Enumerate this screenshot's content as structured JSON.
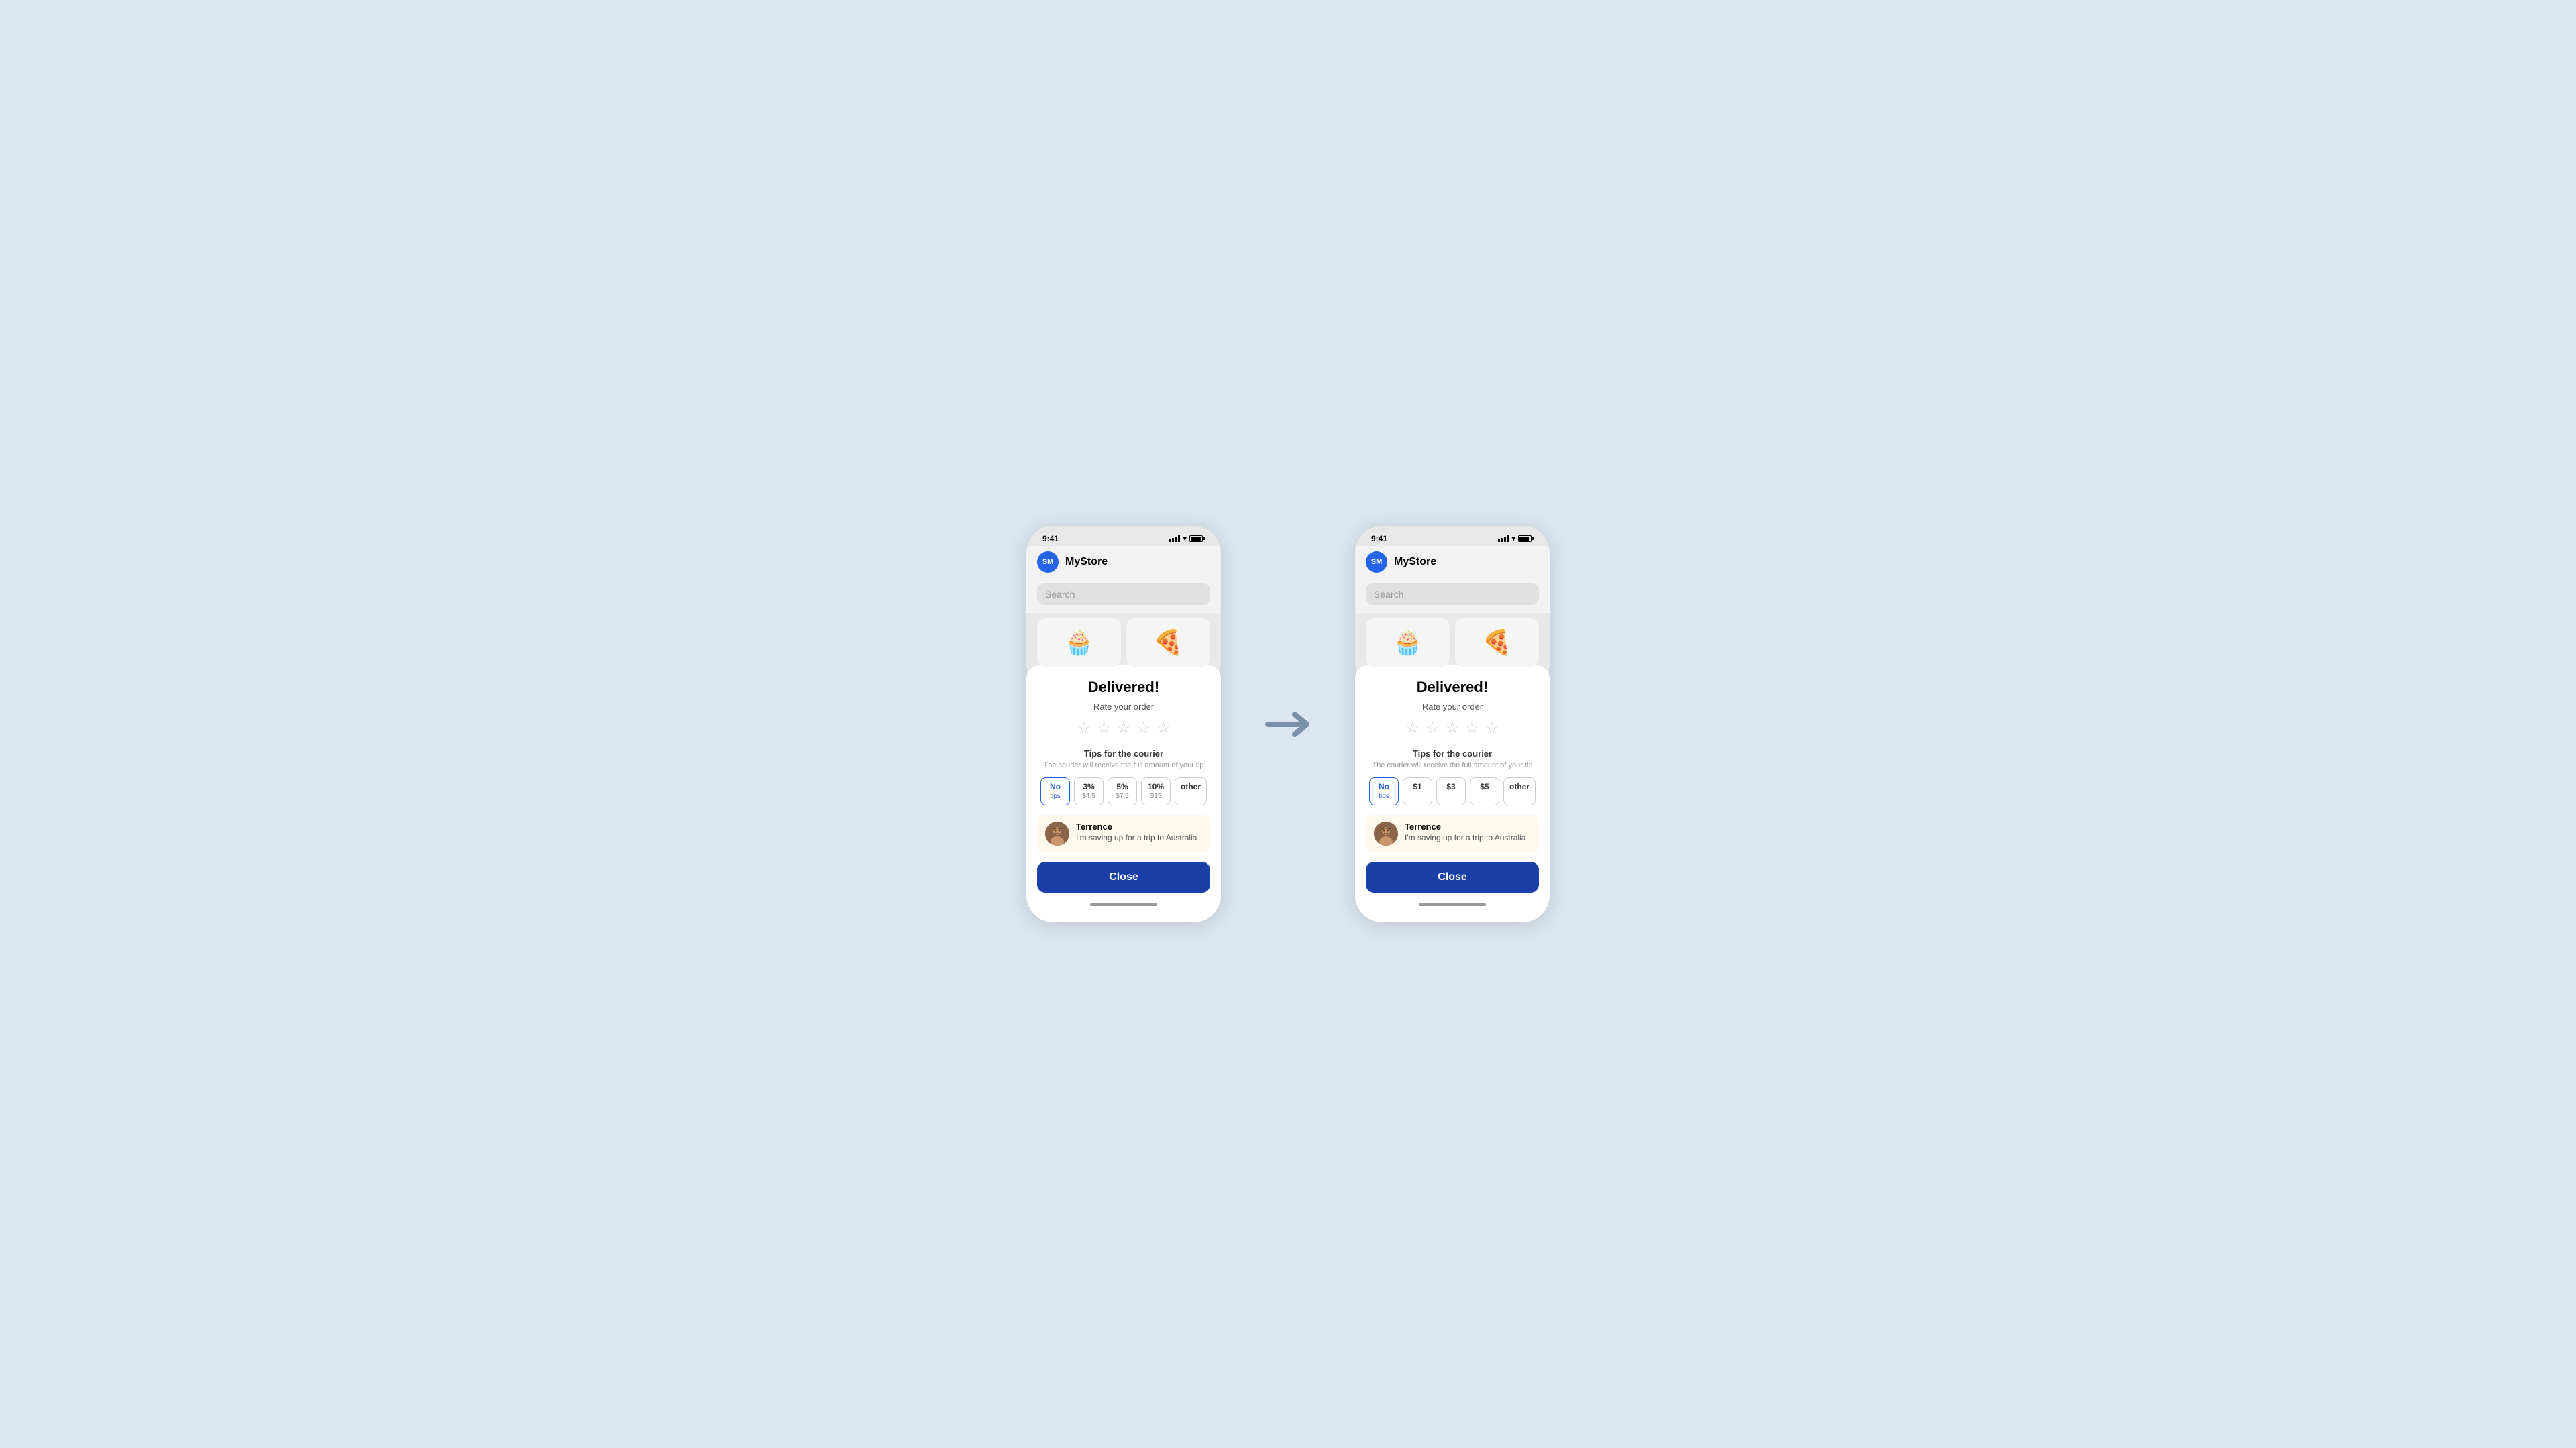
{
  "background_color": "#dde6f0",
  "phone1": {
    "status_bar": {
      "time": "9:41"
    },
    "header": {
      "logo_text": "SM",
      "app_name": "MyStore"
    },
    "search": {
      "placeholder": "Search"
    },
    "products": [
      "🧁",
      "🍕"
    ],
    "sheet": {
      "title": "Delivered!",
      "rate_label": "Rate your order",
      "tips_label": "Tips for the courier",
      "tips_subtitle": "The courier will receive the full amount of your tip",
      "tip_options": [
        {
          "main": "No",
          "sub": "tips",
          "active": true
        },
        {
          "main": "3%",
          "sub": "$4.5",
          "active": false
        },
        {
          "main": "5%",
          "sub": "$7.5",
          "active": false
        },
        {
          "main": "10%",
          "sub": "$15",
          "active": false
        },
        {
          "main": "other",
          "sub": "",
          "active": false
        }
      ],
      "courier": {
        "name": "Terrence",
        "message": "I'm saving up for a trip to Australia",
        "avatar": "👨"
      },
      "close_button": "Close"
    }
  },
  "arrow": "→",
  "phone2": {
    "status_bar": {
      "time": "9:41"
    },
    "header": {
      "logo_text": "SM",
      "app_name": "MyStore"
    },
    "search": {
      "placeholder": "Search"
    },
    "products": [
      "🧁",
      "🍕"
    ],
    "sheet": {
      "title": "Delivered!",
      "rate_label": "Rate your order",
      "tips_label": "Tips for the courier",
      "tips_subtitle": "The courier will receive the full amount of your tip",
      "tip_options": [
        {
          "main": "No",
          "sub": "tips",
          "active": true
        },
        {
          "main": "$1",
          "sub": "",
          "active": false
        },
        {
          "main": "$3",
          "sub": "",
          "active": false
        },
        {
          "main": "$5",
          "sub": "",
          "active": false
        },
        {
          "main": "other",
          "sub": "",
          "active": false
        }
      ],
      "courier": {
        "name": "Terrence",
        "message": "I'm saving up for a trip to Australia",
        "avatar": "👨"
      },
      "close_button": "Close"
    }
  }
}
